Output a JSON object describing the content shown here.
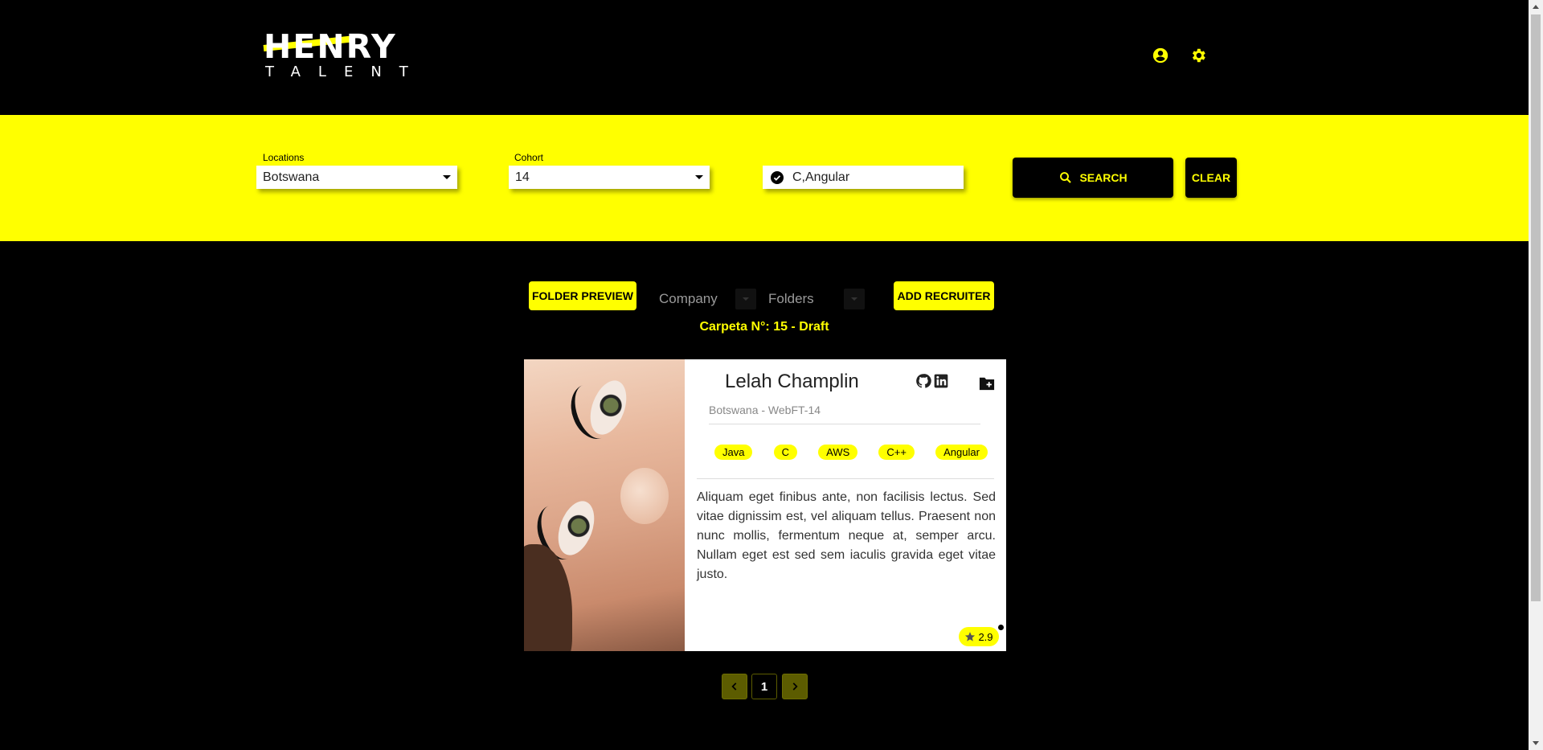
{
  "header": {
    "logo_main": "HENRY",
    "logo_sub": "TALENT",
    "icons": [
      "account-circle-icon",
      "settings-gear-icon"
    ]
  },
  "filters": {
    "locations": {
      "label": "Locations",
      "value": "Botswana"
    },
    "cohort": {
      "label": "Cohort",
      "value": "14"
    },
    "technologies": {
      "value": "C,Angular",
      "icon": "check-circle-icon"
    },
    "search_label": "SEARCH",
    "clear_label": "CLEAR"
  },
  "toolbar": {
    "folder_preview_label": "FOLDER PREVIEW",
    "company_label": "Company",
    "folders_label": "Folders",
    "add_recruiter_label": "ADD RECRUITER",
    "folder_status": "Carpeta N°: 15 - Draft"
  },
  "card": {
    "name": "Lelah Champlin",
    "subtitle": "Botswana - WebFT-14",
    "tags": [
      "Java",
      "C",
      "AWS",
      "C++",
      "Angular"
    ],
    "description": "Aliquam eget finibus ante, non facilisis lectus. Sed vitae dignissim est, vel aliquam tellus. Praesent non nunc mollis, fermentum neque at, semper arcu. Nullam eget est sed sem iaculis gravida eget vitae justo.",
    "rating": "2.9",
    "icons": [
      "github-icon",
      "linkedin-icon",
      "folder-add-icon",
      "star-icon"
    ]
  },
  "pagination": {
    "current_page": "1"
  },
  "colors": {
    "accent": "#ffff00",
    "background": "#000000",
    "card": "#ffffff"
  }
}
